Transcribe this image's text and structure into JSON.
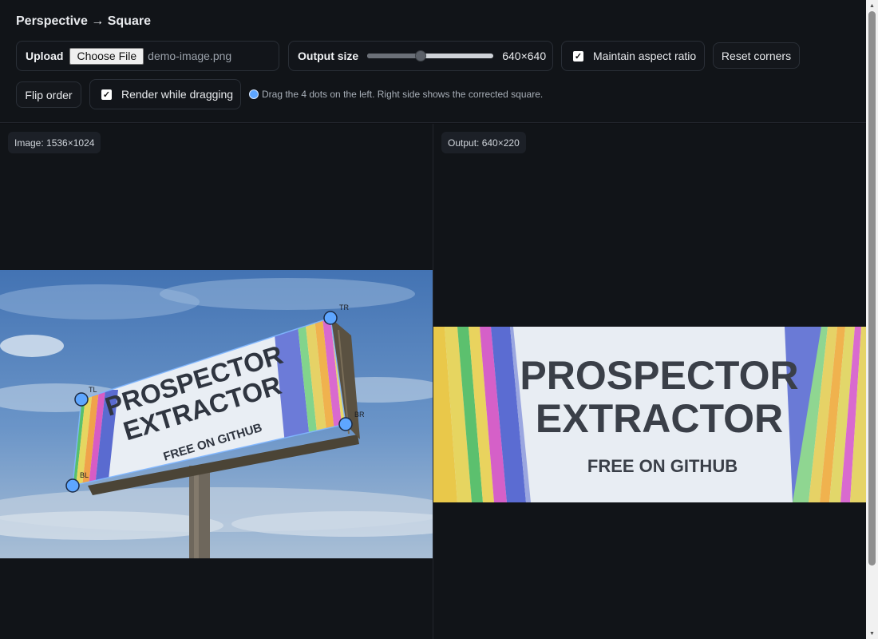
{
  "app": {
    "title": "Perspective → Square"
  },
  "upload": {
    "label": "Upload",
    "button_label": "Choose File",
    "file_name": "demo-image.png"
  },
  "output_size": {
    "label": "Output size",
    "slider_value": 0.42,
    "value": "640×640"
  },
  "maintain_aspect": {
    "label": "Maintain aspect ratio",
    "checked": true
  },
  "reset_button": {
    "label": "Reset corners"
  },
  "flip_button": {
    "label": "Flip order"
  },
  "render_dragging": {
    "label": "Render while dragging",
    "checked": true
  },
  "hint": {
    "text": "Drag the 4 dots on the left. Right side shows the corrected square."
  },
  "left_pane": {
    "badge": "Image: 1536×1024"
  },
  "right_pane": {
    "badge": "Output: 640×220"
  },
  "corners": {
    "tl": "TL",
    "tr": "TR",
    "br": "BR",
    "bl": "BL"
  },
  "billboard": {
    "line1": "PROSPECTOR",
    "line2": "EXTRACTOR",
    "line3": "FREE ON GITHUB"
  },
  "colors": {
    "accent": "#5ea6ff",
    "background": "#0f1115",
    "panel": "#111418",
    "sky": "#4a78b8"
  },
  "icons": {
    "checkbox": "check-icon",
    "hint": "dot-icon"
  }
}
